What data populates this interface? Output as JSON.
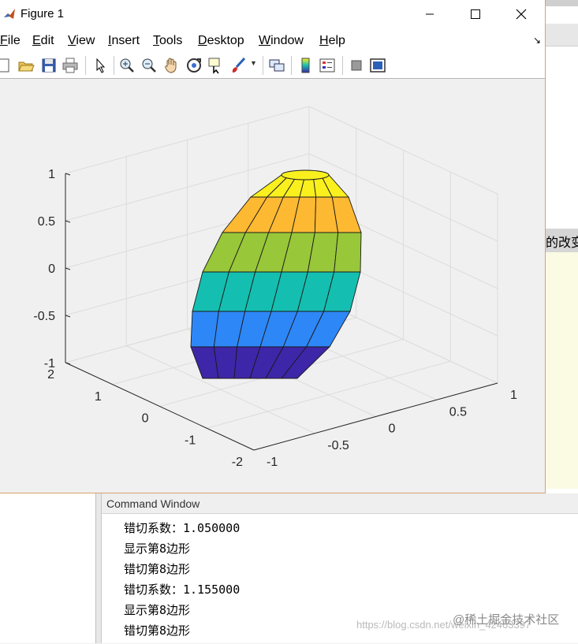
{
  "figure": {
    "title": "Figure 1",
    "menu": [
      "File",
      "Edit",
      "View",
      "Insert",
      "Tools",
      "Desktop",
      "Window",
      "Help"
    ],
    "menu_underline": [
      "F",
      "E",
      "V",
      "I",
      "T",
      "D",
      "W",
      "H"
    ]
  },
  "toolbar": {
    "icons": [
      "new-figure-icon",
      "open-file-icon",
      "save-icon",
      "print-icon",
      "pointer-icon",
      "zoom-in-icon",
      "zoom-out-icon",
      "pan-icon",
      "rotate-3d-icon",
      "data-cursor-icon",
      "brush-icon",
      "link-plot-icon",
      "colorbar-icon",
      "legend-icon",
      "hide-plot-tools-icon",
      "show-plot-tools-icon"
    ]
  },
  "axes": {
    "z_ticks": [
      "1",
      "0.5",
      "0",
      "-0.5",
      "-1"
    ],
    "y_ticks": [
      "2",
      "1",
      "0",
      "-1",
      "-2"
    ],
    "x_ticks": [
      "-1",
      "-0.5",
      "0",
      "0.5",
      "1"
    ]
  },
  "surface_colors": [
    "#3e26a8",
    "#2e87f7",
    "#14bfb1",
    "#98c739",
    "#fdb932",
    "#f9f01e"
  ],
  "background": {
    "partial_text": "的改变"
  },
  "command_window": {
    "title": "Command Window",
    "lines": [
      "错切系数：1.050000",
      "显示第8边形",
      "错切第8边形",
      "错切系数：1.155000",
      "显示第8边形",
      "错切第8边形"
    ]
  },
  "watermark": {
    "url": "https://blog.csdn.net/weixin_42463397",
    "brand": "@稀土掘金技术社区"
  }
}
